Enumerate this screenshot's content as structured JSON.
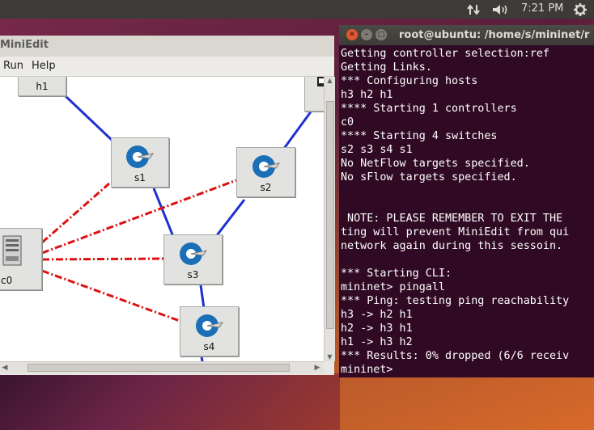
{
  "panel": {
    "clock": "7:21 PM"
  },
  "miniedit": {
    "title": "MiniEdit",
    "menu": [
      "Run",
      "Help"
    ]
  },
  "topology": {
    "nodes": {
      "h1": "h1",
      "s1": "s1",
      "s2": "s2",
      "s3": "s3",
      "s4": "s4",
      "c0": "c0"
    },
    "colors": {
      "data_link": "#1f2fd0",
      "control_link": "#dd1111"
    }
  },
  "terminal": {
    "title": "root@ubuntu: /home/s/mininet/r",
    "lines": [
      "Getting controller selection:ref",
      "Getting Links.",
      "*** Configuring hosts",
      "h3 h2 h1",
      "**** Starting 1 controllers",
      "c0",
      "**** Starting 4 switches",
      "s2 s3 s4 s1",
      "No NetFlow targets specified.",
      "No sFlow targets specified.",
      "",
      "",
      " NOTE: PLEASE REMEMBER TO EXIT THE",
      "ting will prevent MiniEdit from qui",
      "network again during this sessoin.",
      "",
      "*** Starting CLI:",
      "mininet> pingall",
      "*** Ping: testing ping reachability",
      "h3 -> h2 h1",
      "h2 -> h3 h1",
      "h1 -> h3 h2",
      "*** Results: 0% dropped (6/6 receiv",
      "mininet>"
    ],
    "colors": {
      "background": "#300a24",
      "text": "#ffffff"
    }
  }
}
